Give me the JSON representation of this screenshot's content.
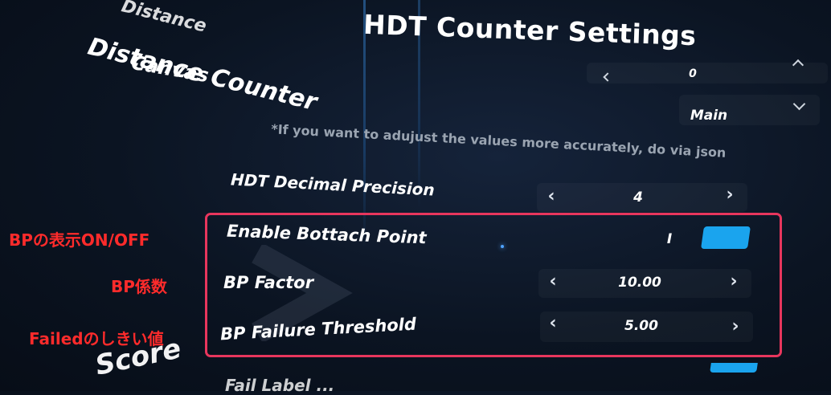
{
  "panel": {
    "title": "HDT Counter Settings",
    "note": "*If you want to adujust the values more accurately, do via json"
  },
  "tabs": {
    "distance_faded": "Distance",
    "distance_counter": "Distance Counter",
    "canvas": "Canvas",
    "score": "Score"
  },
  "top_rows": {
    "partial_value": "0",
    "canvas_value": "Main"
  },
  "settings": {
    "decimal_precision": {
      "label": "HDT Decimal Precision",
      "value": "4"
    },
    "enable_bottach": {
      "label": "Enable Bottach Point",
      "value": "I"
    },
    "bp_factor": {
      "label": "BP Factor",
      "value": "10.00"
    },
    "bp_failure": {
      "label": "BP Failure Threshold",
      "value": "5.00"
    },
    "below_partial": "Fail Label ..."
  },
  "annotations": {
    "bp_display": "BPの表示ON/OFF",
    "bp_factor": "BP係数",
    "failed_threshold": "Failedのしきい値"
  },
  "colors": {
    "toggle_on": "#1aa4ee",
    "highlight_border": "#e8365d",
    "annotation_text": "#ff2b2b"
  }
}
